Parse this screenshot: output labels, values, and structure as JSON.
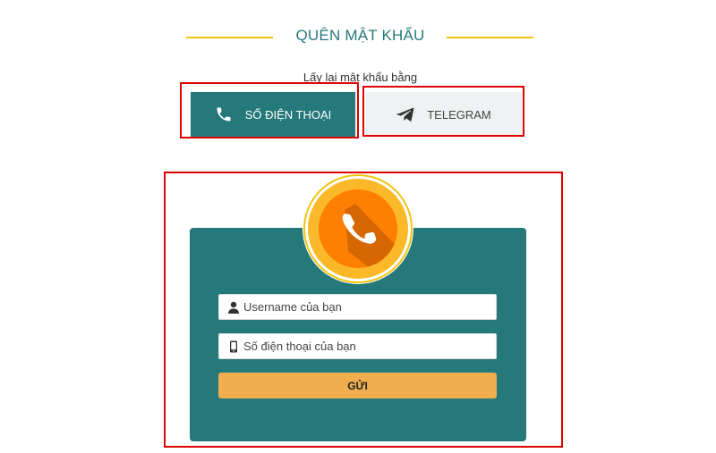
{
  "page": {
    "title": "QUÊN MẬT KHẨU",
    "subtitle": "Lấy lại mật khẩu bằng"
  },
  "tabs": [
    {
      "label": "SỐ ĐIỆN THOẠI",
      "icon": "phone-icon",
      "active": true
    },
    {
      "label": "TELEGRAM",
      "icon": "telegram-icon",
      "active": false
    }
  ],
  "form": {
    "username_placeholder": "Username của bạn",
    "username_value": "",
    "phone_placeholder": "Số điện thoại của bạn",
    "phone_value": "",
    "submit_label": "GỬI"
  },
  "colors": {
    "teal": "#25797b",
    "gold": "#f1c40f",
    "orange": "#ff7f00",
    "submit": "#f0ae4e",
    "highlight": "#e00000"
  },
  "icons": [
    "phone-icon",
    "telegram-icon",
    "phone-badge-icon",
    "user-icon",
    "mobile-icon"
  ]
}
